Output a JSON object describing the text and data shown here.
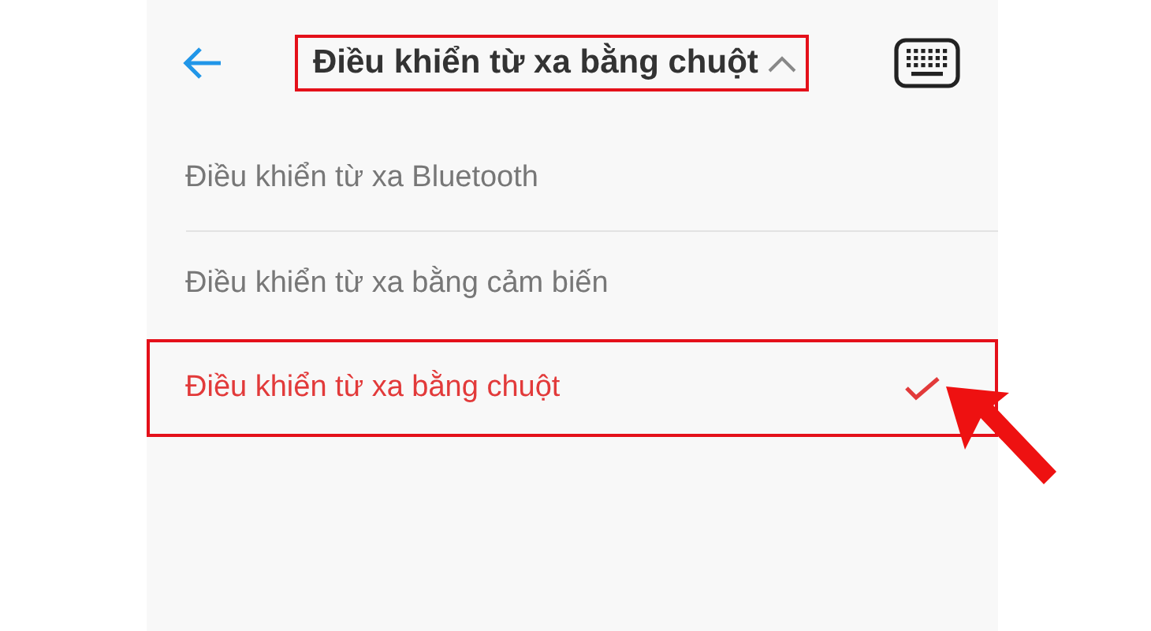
{
  "header": {
    "title": "Điều khiển từ xa bằng chuột",
    "highlighted": true
  },
  "options": [
    {
      "label": "Điều khiển từ xa Bluetooth",
      "selected": false
    },
    {
      "label": "Điều khiển từ xa bằng cảm biến",
      "selected": false
    },
    {
      "label": "Điều khiển từ xa bằng chuột",
      "selected": true
    }
  ]
}
